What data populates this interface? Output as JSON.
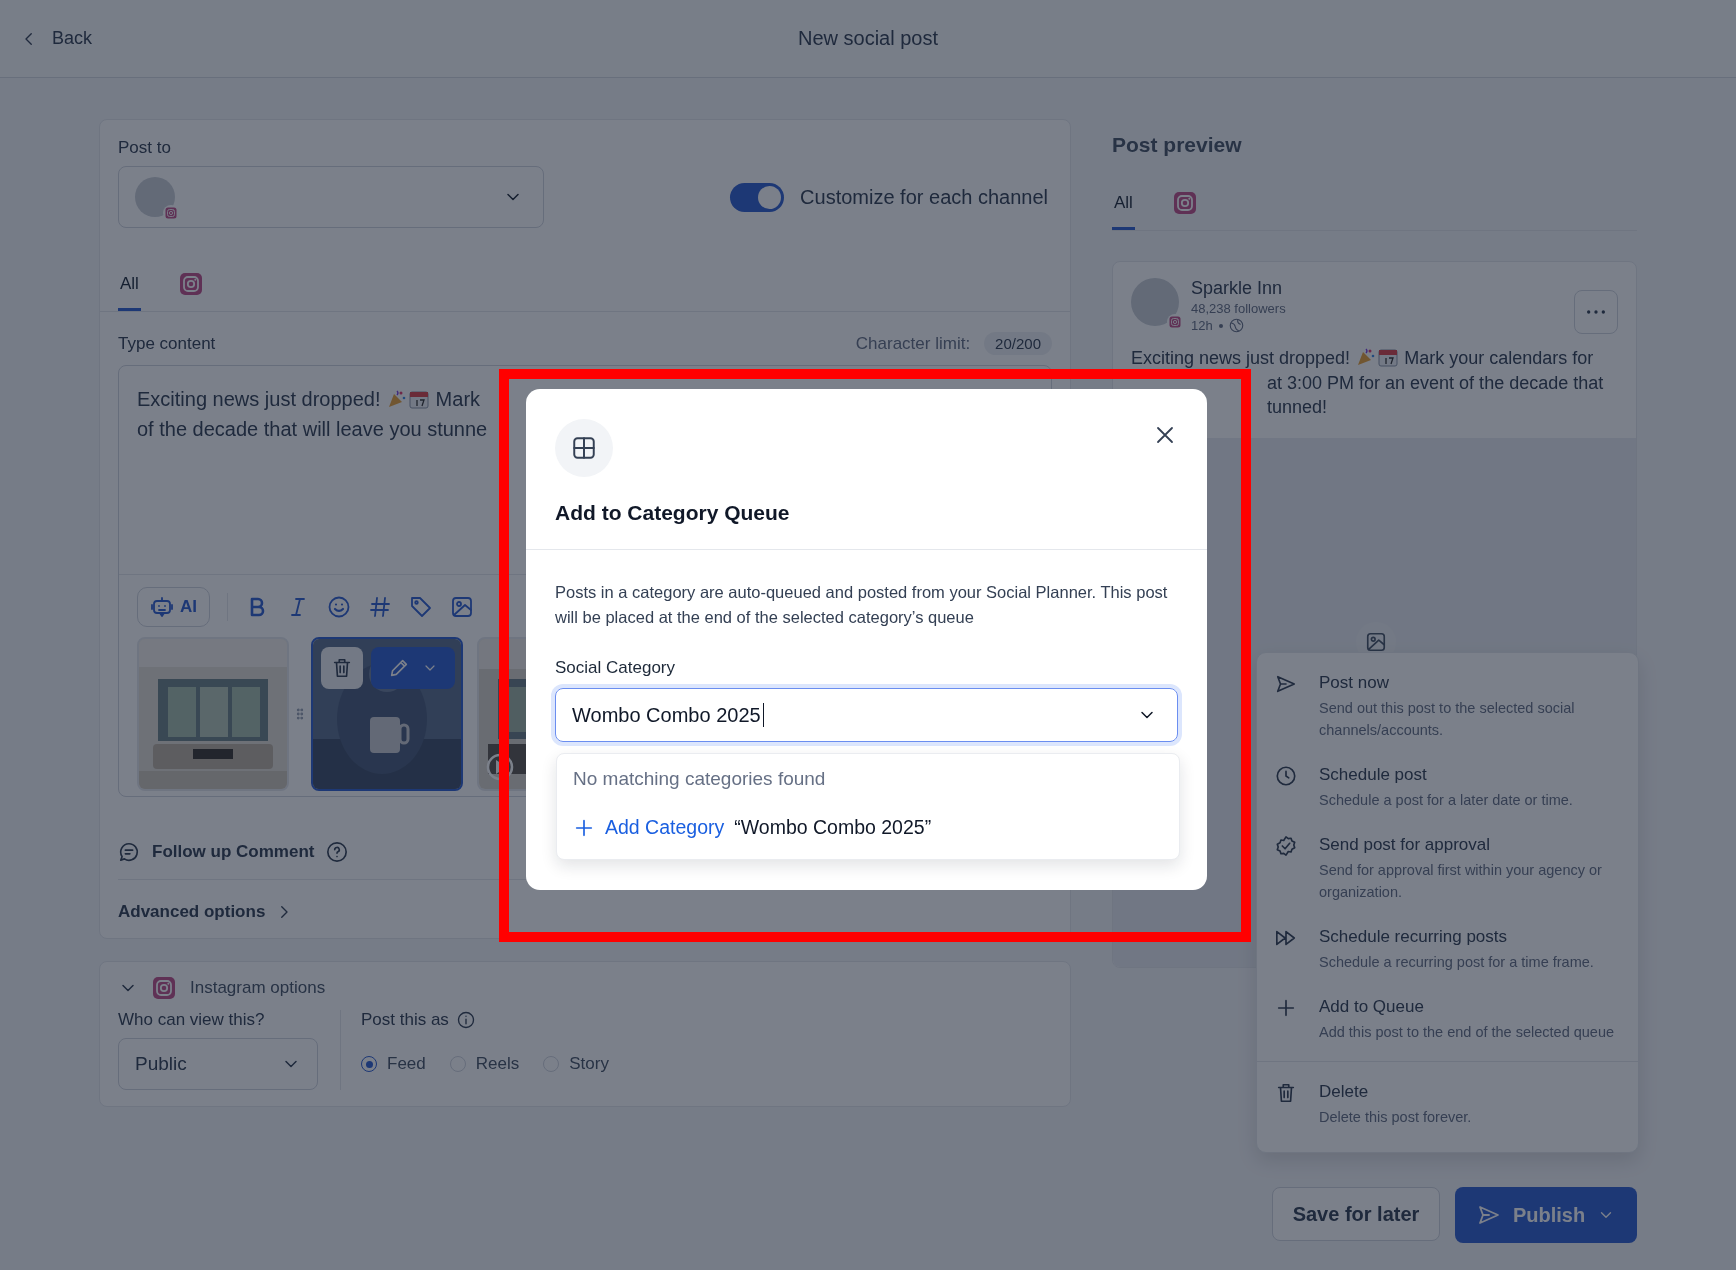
{
  "header": {
    "back": "Back",
    "title": "New social post"
  },
  "composer": {
    "post_to_label": "Post to",
    "customize_toggle": {
      "label": "Customize for each channel",
      "on": true
    },
    "tabs": [
      {
        "kind": "text",
        "label": "All",
        "selected": true
      },
      {
        "kind": "instagram",
        "selected": false
      }
    ],
    "content_label": "Type content",
    "char_limit_label": "Character limit:",
    "char_count": "20/200",
    "content_line_1": {
      "before": "Exciting news just dropped!",
      "after": "Mark"
    },
    "content_line_2": "of the decade that will leave you stunne",
    "ai_button": "AI",
    "media": [
      {
        "kind": "picture",
        "selected": false
      },
      {
        "kind": "picture",
        "selected": true
      },
      {
        "kind": "video",
        "selected": false
      }
    ],
    "follow_up": "Follow up Comment",
    "advanced": "Advanced options"
  },
  "instagram_options": {
    "title": "Instagram options",
    "expanded": true,
    "who_label": "Who can view this?",
    "who_value": "Public",
    "post_as_label": "Post this as",
    "post_as": [
      {
        "label": "Feed",
        "selected": true
      },
      {
        "label": "Reels",
        "selected": false
      },
      {
        "label": "Story",
        "selected": false
      }
    ]
  },
  "preview": {
    "title": "Post preview",
    "tabs": [
      {
        "kind": "text",
        "label": "All",
        "selected": true
      },
      {
        "kind": "instagram",
        "selected": false
      }
    ],
    "account": "Sparkle Inn",
    "followers": "48,238 followers",
    "age": "12h",
    "line_1": {
      "before": "Exciting news just dropped!",
      "after": "Mark your calendars for"
    },
    "line_2": "at 3:00 PM for an event of the decade that",
    "line_3": "tunned!"
  },
  "publish_menu": [
    {
      "kind": "send",
      "title": "Post now",
      "description": "Send out this post to the selected social channels/accounts."
    },
    {
      "kind": "clock",
      "title": "Schedule post",
      "description": "Schedule a post for a later date or time."
    },
    {
      "kind": "badge",
      "title": "Send post for approval",
      "description": "Send for approval first within your agency or organization."
    },
    {
      "kind": "recurring",
      "title": "Schedule recurring posts",
      "description": "Schedule a recurring post for a time frame."
    },
    {
      "kind": "plus",
      "title": "Add to Queue",
      "description": "Add this post to the end of the selected queue"
    },
    {
      "kind": "trash",
      "title": "Delete",
      "description": "Delete this post forever."
    }
  ],
  "actions": {
    "save": "Save for later",
    "publish": "Publish"
  },
  "modal": {
    "title": "Add to Category Queue",
    "description": "Posts in a category are auto-queued and posted from your Social Planner. This post will be placed at the end of the selected category’s queue",
    "field_label": "Social Category",
    "value": "Wombo Combo 2025",
    "empty": "No matching categories found",
    "add_action": "Add Category",
    "add_value": "“Wombo Combo 2025”"
  }
}
